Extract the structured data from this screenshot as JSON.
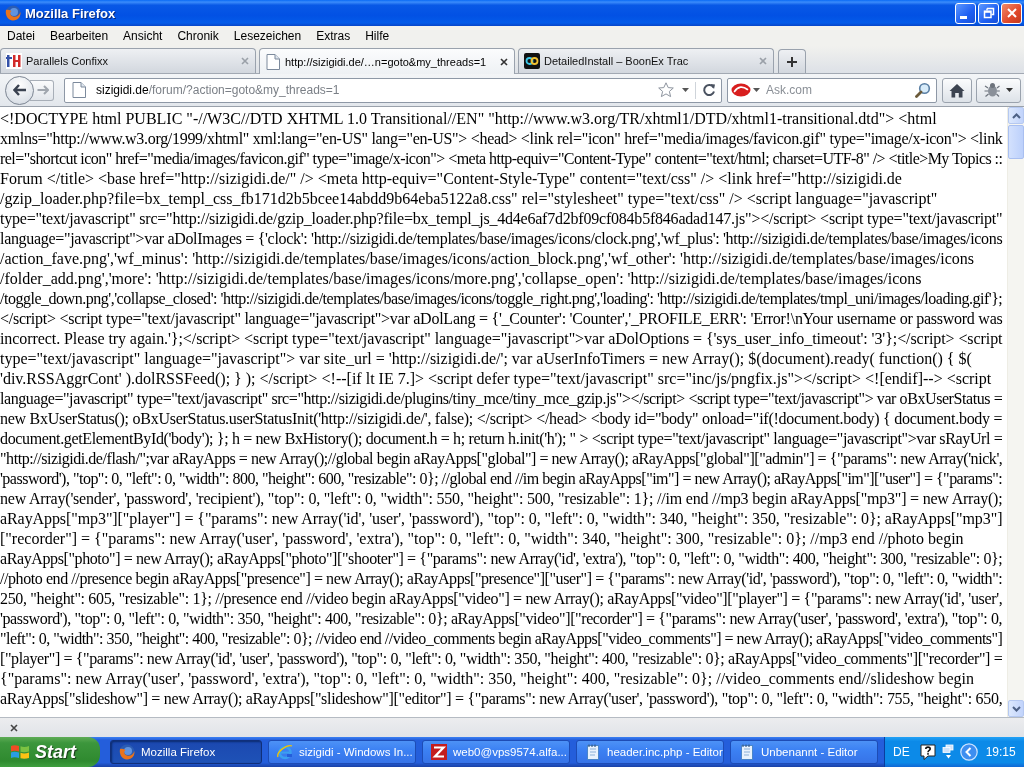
{
  "window": {
    "title": "Mozilla Firefox"
  },
  "menu": [
    "Datei",
    "Bearbeiten",
    "Ansicht",
    "Chronik",
    "Lesezeichen",
    "Extras",
    "Hilfe"
  ],
  "tabs": [
    {
      "label": "Parallels Confixx",
      "selected": false
    },
    {
      "label": "http://sizigidi.de/…n=goto&my_threads=1",
      "selected": true
    },
    {
      "label": "DetailedInstall – BoonEx Trac",
      "selected": false
    }
  ],
  "address": {
    "host": "sizigidi.de",
    "path": "/forum/?action=goto&my_threads=1"
  },
  "search": {
    "placeholder": "Ask.com"
  },
  "source_lines": [
    "<!DOCTYPE html PUBLIC \"-//W3C//DTD XHTML 1.0 Transitional//EN\" \"http://www.w3.org/TR/xhtml1/DTD/xhtml1-transitional.dtd\"> <html",
    "xmlns=\"http://www.w3.org/1999/xhtml\" xml:lang=\"en-US\" lang=\"en-US\"> <head> <link rel=\"icon\" href=\"media/images/favicon.gif\" type=\"image/x-icon\"> <link",
    "rel=\"shortcut icon\" href=\"media/images/favicon.gif\" type=\"image/x-icon\"> <meta http-equiv=\"Content-Type\" content=\"text/html; charset=UTF-8\" /> <title>My Topics ::",
    "Forum </title> <base href=\"http://sizigidi.de/\" /> <meta http-equiv=\"Content-Style-Type\" content=\"text/css\" /> <link href=\"http://sizigidi.de",
    "/gzip_loader.php?file=bx_templ_css_fb171d2b5bcee14abdd9b64eba5122a8.css\" rel=\"stylesheet\" type=\"text/css\" /> <script language=\"javascript\"",
    "type=\"text/javascript\" src=\"http://sizigidi.de/gzip_loader.php?file=bx_templ_js_4d4e6af7d2bf09cf084b5f846adad147.js\"></script> <script type=\"text/javascript\"",
    "language=\"javascript\">var aDolImages = {'clock': 'http://sizigidi.de/templates/base/images/icons/clock.png','wf_plus': 'http://sizigidi.de/templates/base/images/icons",
    "/action_fave.png','wf_minus': 'http://sizigidi.de/templates/base/images/icons/action_block.png','wf_other': 'http://sizigidi.de/templates/base/images/icons",
    "/folder_add.png','more': 'http://sizigidi.de/templates/base/images/icons/more.png','collapse_open': 'http://sizigidi.de/templates/base/images/icons",
    "/toggle_down.png','collapse_closed': 'http://sizigidi.de/templates/base/images/icons/toggle_right.png','loading': 'http://sizigidi.de/templates/tmpl_uni/images/loading.gif'};",
    "</script> <script type=\"text/javascript\" language=\"javascript\">var aDolLang = {'_Counter': 'Counter','_PROFILE_ERR': 'Error!\\nYour username or password was",
    "incorrect. Please try again.'};</script> <script type=\"text/javascript\" language=\"javascript\">var aDolOptions = {'sys_user_info_timeout': '3'};</script> <script",
    "type=\"text/javascript\" language=\"javascript\"> var site_url = 'http://sizigidi.de/'; var aUserInfoTimers = new Array(); $(document).ready( function() { $(",
    "'div.RSSAggrCont' ).dolRSSFeed(); } ); </script> <!--[if lt IE 7.]> <script defer type=\"text/javascript\" src=\"inc/js/pngfix.js\"></script> <![endif]--> <script",
    "language=\"javascript\" type=\"text/javascript\" src=\"http://sizigidi.de/plugins/tiny_mce/tiny_mce_gzip.js\"></script> <script type=\"text/javascript\"> var oBxUserStatus =",
    "new BxUserStatus(); oBxUserStatus.userStatusInit('http://sizigidi.de/', false); </script> </head> <body id=\"body\" onload=\"if(!document.body) { document.body =",
    "document.getElementById('body'); }; h = new BxHistory(); document.h = h; return h.init('h'); \" > <script type=\"text/javascript\" language=\"javascript\">var sRayUrl =",
    "\"http://sizigidi.de/flash/\";var aRayApps = new Array();//global begin aRayApps[\"global\"] = new Array(); aRayApps[\"global\"][\"admin\"] = {\"params\": new Array('nick',",
    "'password'), \"top\": 0, \"left\": 0, \"width\": 800, \"height\": 600, \"resizable\": 0}; //global end //im begin aRayApps[\"im\"] = new Array(); aRayApps[\"im\"][\"user\"] = {\"params\":",
    "new Array('sender', 'password', 'recipient'), \"top\": 0, \"left\": 0, \"width\": 550, \"height\": 500, \"resizable\": 1}; //im end //mp3 begin aRayApps[\"mp3\"] = new Array();",
    "aRayApps[\"mp3\"][\"player\"] = {\"params\": new Array('id', 'user', 'password'), \"top\": 0, \"left\": 0, \"width\": 340, \"height\": 350, \"resizable\": 0}; aRayApps[\"mp3\"]",
    "[\"recorder\"] = {\"params\": new Array('user', 'password', 'extra'), \"top\": 0, \"left\": 0, \"width\": 340, \"height\": 300, \"resizable\": 0}; //mp3 end //photo begin",
    "aRayApps[\"photo\"] = new Array(); aRayApps[\"photo\"][\"shooter\"] = {\"params\": new Array('id', 'extra'), \"top\": 0, \"left\": 0, \"width\": 400, \"height\": 300, \"resizable\": 0};",
    "//photo end //presence begin aRayApps[\"presence\"] = new Array(); aRayApps[\"presence\"][\"user\"] = {\"params\": new Array('id', 'password'), \"top\": 0, \"left\": 0, \"width\":",
    "250, \"height\": 605, \"resizable\": 1}; //presence end //video begin aRayApps[\"video\"] = new Array(); aRayApps[\"video\"][\"player\"] = {\"params\": new Array('id', 'user',",
    "'password'), \"top\": 0, \"left\": 0, \"width\": 350, \"height\": 400, \"resizable\": 0}; aRayApps[\"video\"][\"recorder\"] = {\"params\": new Array('user', 'password', 'extra'), \"top\": 0,",
    "\"left\": 0, \"width\": 350, \"height\": 400, \"resizable\": 0}; //video end //video_comments begin aRayApps[\"video_comments\"] = new Array(); aRayApps[\"video_comments\"]",
    "[\"player\"] = {\"params\": new Array('id', 'user', 'password'), \"top\": 0, \"left\": 0, \"width\": 350, \"height\": 400, \"resizable\": 0}; aRayApps[\"video_comments\"][\"recorder\"] =",
    "{\"params\": new Array('user', 'password', 'extra'), \"top\": 0, \"left\": 0, \"width\": 350, \"height\": 400, \"resizable\": 0}; //video_comments end//slideshow begin",
    "aRayApps[\"slideshow\"] = new Array(); aRayApps[\"slideshow\"][\"editor\"] = {\"params\": new Array('user', 'password'), \"top\": 0, \"left\": 0, \"width\": 755, \"height\": 650,"
  ],
  "taskbar": {
    "start": "Start",
    "tasks": [
      {
        "label": "Mozilla Firefox",
        "selected": true
      },
      {
        "label": "sizigidi - Windows In...",
        "selected": false
      },
      {
        "label": "web0@vps9574.alfa...",
        "selected": false
      },
      {
        "label": "header.inc.php - Editor",
        "selected": false
      },
      {
        "label": "Unbenannt - Editor",
        "selected": false
      }
    ],
    "language": "DE",
    "clock": "19:15"
  }
}
